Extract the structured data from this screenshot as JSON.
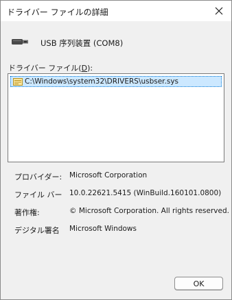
{
  "window": {
    "title": "ドライバー ファイルの詳細",
    "close_icon": "close-icon"
  },
  "device": {
    "icon": "usb-cable-icon",
    "name": "USB 序列装置 (COM8)"
  },
  "driver_files": {
    "label_prefix": "ドライバー ファイル(",
    "label_accesskey": "D",
    "label_suffix": "):",
    "items": [
      {
        "icon": "driver-file-icon",
        "path": "C:\\Windows\\system32\\DRIVERS\\usbser.sys"
      }
    ]
  },
  "details": {
    "provider": {
      "label": "プロバイダー:",
      "value": "Microsoft Corporation"
    },
    "file_version": {
      "label": "ファイル バー",
      "value": "10.0.22621.5415 (WinBuild.160101.0800)"
    },
    "copyright": {
      "label": "著作権:",
      "value": "© Microsoft Corporation. All rights reserved."
    },
    "digital_signer": {
      "label": "デジタル署名",
      "value": "Microsoft Windows"
    }
  },
  "buttons": {
    "ok": "OK"
  }
}
